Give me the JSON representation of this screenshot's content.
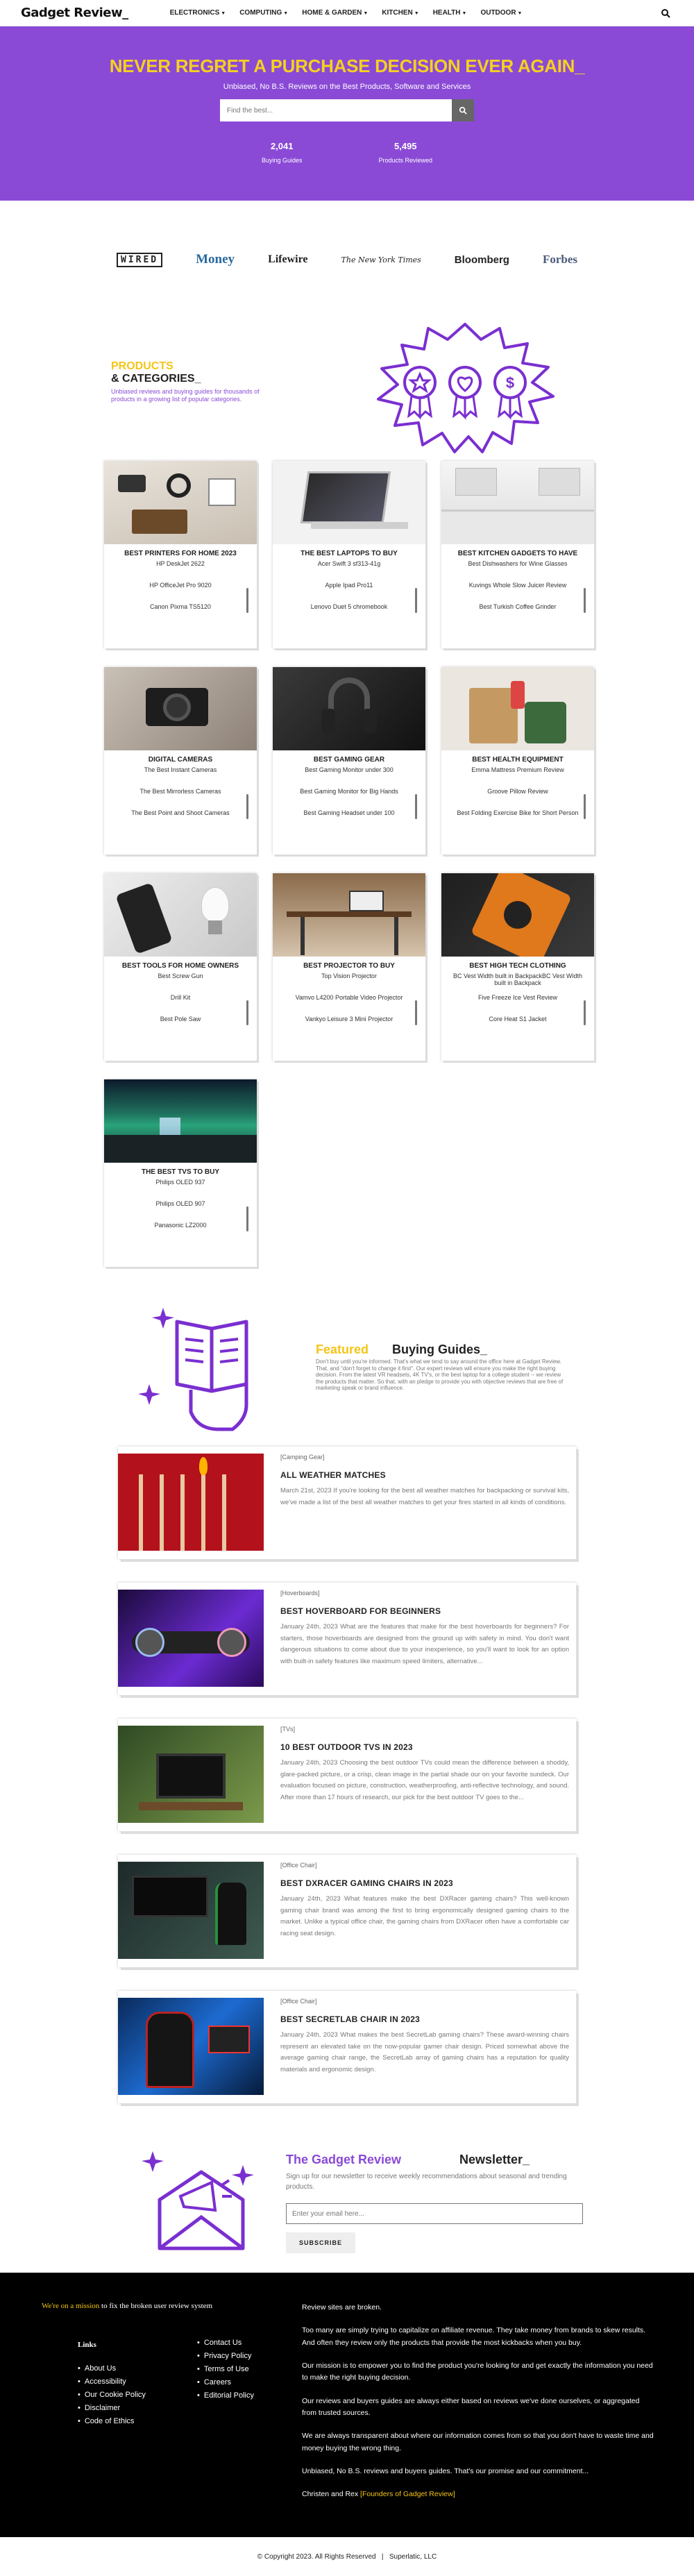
{
  "nav": {
    "logo": "Gadget Review_",
    "menu": [
      "ELECTRONICS",
      "COMPUTING",
      "HOME & GARDEN",
      "KITCHEN",
      "HEALTH",
      "OUTDOOR"
    ]
  },
  "hero": {
    "title": "NEVER REGRET A PURCHASE DECISION EVER AGAIN_",
    "subtitle": "Unbiased, No B.S. Reviews on the Best Products, Software and Services",
    "search_placeholder": "Find the best...",
    "stats": [
      {
        "num": "2,041",
        "label": "Buying Guides"
      },
      {
        "num": "5,495",
        "label": "Products Reviewed"
      }
    ]
  },
  "press_logos": [
    "WIRED",
    "Money",
    "Lifewire",
    "The New York Times",
    "Bloomberg",
    "Forbes"
  ],
  "categories_section": {
    "title_1": "PRODUCTS",
    "title_2": "& CATEGORIES_",
    "description": "Unbiased reviews and buying guides for thousands of products in a growing list of popular categories."
  },
  "cards": [
    {
      "title": "BEST PRINTERS FOR HOME 2023",
      "items": [
        "HP DeskJet 2622",
        "HP OfficeJet Pro 9020",
        "Canon Pixma TS5120"
      ]
    },
    {
      "title": "THE BEST LAPTOPS TO BUY",
      "items": [
        "Acer Swift 3 sf313-41g",
        "Apple Ipad Pro11",
        "Lenovo Duet 5 chromebook"
      ]
    },
    {
      "title": "BEST KITCHEN GADGETS TO HAVE",
      "items": [
        "Best Dishwashers for Wine Glasses",
        "Kuvings Whole Slow Juicer Review",
        "Best Turkish Coffee Grinder"
      ]
    },
    {
      "title": "DIGITAL CAMERAS",
      "items": [
        "The Best Instant Cameras",
        "The Best Mirrorless Cameras",
        "The Best Point and Shoot Cameras"
      ]
    },
    {
      "title": "BEST GAMING GEAR",
      "items": [
        "Best Gaming Monitor under 300",
        "Best Gaming Monitor for Big Hands",
        "Best Gaming Headset under 100"
      ]
    },
    {
      "title": "BEST HEALTH EQUIPMENT",
      "items": [
        "Emma Mattress Premium Review",
        "Groove Pillow Review",
        "Best Folding Exercise Bike for Short Person"
      ]
    },
    {
      "title": "BEST TOOLS FOR HOME OWNERS",
      "items": [
        "Best Screw Gun",
        "Drill Kit",
        "Best Pole Saw"
      ]
    },
    {
      "title": "BEST PROJECTOR TO BUY",
      "items": [
        "Top Vision Projector",
        "Vamvo L4200 Portable Video Projector",
        "Vankyo Leisure 3 Mini Projector"
      ]
    },
    {
      "title": "BEST HIGH TECH CLOTHING",
      "items": [
        "BC Vest Width built in BackpackBC Vest Width built in Backpack",
        "Five Freeze Ice Vest Review",
        "Core Heat S1 Jacket"
      ]
    },
    {
      "title": "THE BEST TVS TO BUY",
      "items": [
        "Philips OLED 937",
        "Philips OLED 907",
        "Panasonic LZ2000"
      ]
    }
  ],
  "featured": {
    "title_1": "Featured",
    "title_2": "Buying Guides_",
    "description": "Don't buy until you're informed. That's what we tend to say around the office here at Gadget Review. That, and \"don't forget to change it first\". Our expert reviews will ensure you make the right buying decision. From the latest VR headsets, 4K TV's, or the best laptop for a college student -- we review the products that matter. So that, with an pledge to provide you with objective reviews that are free of marketing speak or brand influence."
  },
  "posts": [
    {
      "category": "[Camping Gear]",
      "title": "ALL WEATHER MATCHES",
      "text": "March 21st, 2023 If you're looking for the best all weather matches for backpacking or survival kits, we've made a list of the best all weather matches to get your fires started in all kinds of conditions."
    },
    {
      "category": "[Hoverboards]",
      "title": "BEST HOVERBOARD FOR BEGINNERS",
      "text": "January 24th, 2023 What are the features that make for the best hoverboards for beginners? For starters, those hoverboards are designed from the ground up with safety in mind. You don't want dangerous situations to come about due to your inexperience, so you'll want to look for an option with built-in safety features like maximum speed limiters, alternative..."
    },
    {
      "category": "[TVs]",
      "title": "10 BEST OUTDOOR TVS IN 2023",
      "text": "January 24th, 2023 Choosing the best outdoor TVs could mean the difference between a shoddy, glare-packed picture, or a crisp, clean image in the partial shade our on your favorite sundeck. Our evaluation focused on picture, construction, weatherproofing, anti-reflective technology, and sound. After more than 17 hours of research, our pick for the best outdoor TV goes to the..."
    },
    {
      "category": "[Office Chair]",
      "title": "BEST DXRACER GAMING CHAIRS IN 2023",
      "text": "January 24th, 2023 What features make the best DXRacer gaming chairs? This well-known gaming chair brand was among the first to bring ergonomically designed gaming chairs to the market. Unlike a typical office chair, the gaming chairs from DXRacer often have a comfortable car racing seat design."
    },
    {
      "category": "[Office Chair]",
      "title": "BEST SECRETLAB CHAIR IN 2023",
      "text": "January 24th, 2023 What makes the best SecretLab gaming chairs? These award-winning chairs represent an elevated take on the now-popular gamer chair design. Priced somewhat above the average gaming chair range, the SecretLab array of gaming chairs has a reputation for quality materials and ergonomic design."
    }
  ],
  "newsletter": {
    "title_1": "The Gadget Review",
    "title_2": "Newsletter_",
    "description": "Sign up for our newsletter to receive weekly recommendations about seasonal and trending products.",
    "placeholder": "Enter your email here...",
    "button": "SUBSCRIBE"
  },
  "footer": {
    "mission_1": "We're on a mission",
    "mission_2": " to fix the broken user review system",
    "links_title": "Links",
    "links_left": [
      "About Us",
      "Accessibility",
      "Our Cookie Policy",
      "Disclaimer",
      "Code of Ethics"
    ],
    "links_right": [
      "Contact Us",
      "Privacy Policy",
      "Terms of Use",
      "Careers",
      "Editorial Policy"
    ],
    "about": [
      "Review sites are broken.",
      "Too many are simply trying to capitalize on affiliate revenue. They take money from brands to skew results. And often they review only the products that provide the most kickbacks when you buy.",
      "Our mission is to empower you to find the product you're looking for and get exactly the information you need to make the right buying decision.",
      "Our reviews and buyers guides are always either based on reviews we've done ourselves, or aggregated from trusted sources.",
      "We are always transparent about where our information comes from so that you don't have to waste time and money buying the wrong thing.",
      "Unbiased, No B.S. reviews and buyers guides. That's our promise and our commitment..."
    ],
    "signoff": "Christen and Rex ",
    "signoff_link": "[Founders of Gadget Review]",
    "copyright": "© Copyright 2023. All Rights Reserved   |   Superlatic, LLC"
  }
}
